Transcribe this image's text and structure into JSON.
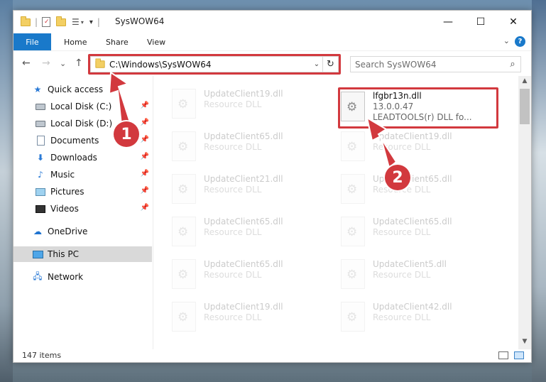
{
  "window": {
    "title": "SysWOW64",
    "controls": {
      "minimize": "—",
      "maximize": "☐",
      "close": "✕"
    }
  },
  "ribbon": {
    "tabs": [
      "File",
      "Home",
      "Share",
      "View"
    ],
    "expand_chevron": "⌄",
    "help": "?"
  },
  "navbar": {
    "back": "←",
    "forward": "→",
    "recent": "⌄",
    "up": "↑",
    "address": "C:\\Windows\\SysWOW64",
    "address_dropdown": "⌄",
    "refresh": "↻",
    "search_placeholder": "Search SysWOW64",
    "search_icon": "⌕"
  },
  "sidebar": {
    "items": [
      {
        "label": "Quick access",
        "icon": "star-icon"
      },
      {
        "label": "Local Disk (C:)",
        "icon": "drive-icon",
        "pinned": true
      },
      {
        "label": "Local Disk (D:)",
        "icon": "drive-icon",
        "pinned": true
      },
      {
        "label": "Documents",
        "icon": "documents-icon",
        "pinned": true
      },
      {
        "label": "Downloads",
        "icon": "downloads-icon",
        "pinned": true
      },
      {
        "label": "Music",
        "icon": "music-icon",
        "pinned": true
      },
      {
        "label": "Pictures",
        "icon": "pictures-icon",
        "pinned": true
      },
      {
        "label": "Videos",
        "icon": "videos-icon",
        "pinned": true
      },
      {
        "label": "OneDrive",
        "icon": "onedrive-icon"
      },
      {
        "label": "This PC",
        "icon": "computer-icon",
        "selected": true
      },
      {
        "label": "Network",
        "icon": "network-icon"
      }
    ],
    "pin_glyph": "📌"
  },
  "files": {
    "left_column": [
      {
        "name": "UpdateClient19.dll",
        "type": "Resource DLL"
      },
      {
        "name": "UpdateClient65.dll",
        "type": "Resource DLL"
      },
      {
        "name": "UpdateClient21.dll",
        "type": "Resource DLL"
      },
      {
        "name": "UpdateClient65.dll",
        "type": "Resource DLL"
      },
      {
        "name": "UpdateClient65.dll",
        "type": "Resource DLL"
      },
      {
        "name": "UpdateClient19.dll",
        "type": "Resource DLL"
      }
    ],
    "highlighted": {
      "name": "lfgbr13n.dll",
      "version": "13.0.0.47",
      "description": "LEADTOOLS(r) DLL fo..."
    },
    "right_column": [
      {
        "name": "UpdateClient19.dll",
        "type": "Resource DLL"
      },
      {
        "name": "UpdateClient65.dll",
        "type": "Resource DLL"
      },
      {
        "name": "UpdateClient65.dll",
        "type": "Resource DLL"
      },
      {
        "name": "UpdateClient5.dll",
        "type": "Resource DLL"
      },
      {
        "name": "UpdateClient42.dll",
        "type": "Resource DLL"
      }
    ]
  },
  "statusbar": {
    "item_count": "147 items"
  },
  "annotations": {
    "step1": "1",
    "step2": "2",
    "accent": "#d2393e"
  },
  "colors": {
    "file_tab": "#1979ca",
    "selection": "#d9d9d9",
    "highlight": "#d2393e"
  }
}
